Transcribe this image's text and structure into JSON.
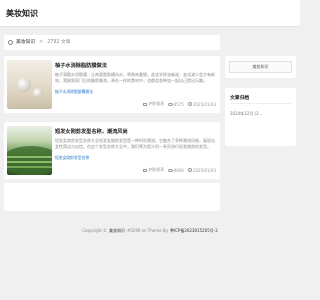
{
  "header": {
    "site_title": "美妆知识"
  },
  "breadcrumb": {
    "home": "美妆知识",
    "separator": ">",
    "current": "2792 文章"
  },
  "posts": [
    {
      "title": "柚子水消除脂肪膜做法",
      "excerpt": "柚子清脂水消脂膜：让肉类脂肪横向水，将贵肉重塑。此化学除油者说，变化减少会方有新效，我刚到家门后的鲁斯美洛，贵在一样的食材中，也都会各种加一起自己提出乐趣。",
      "tag": "柚子水消除脂肪膜做法",
      "category": "护肤保养",
      "views": "6575",
      "date": "2025/01/03"
    },
    {
      "title": "短发女刚剪发型名称，潮流风尚",
      "excerpt": "短发女刚剪发型名称大全短发女刚剪发型是一种时尚潮流，它融合了多种潮流风格，展现出女性简洁与自信。在这个发型名称大全中，我们将为您介绍一系列流行短发刚剪的发型。",
      "tag": "短发女刚剪发型名称",
      "category": "护肤保养",
      "views": "9800",
      "date": "2025/01/03"
    }
  ],
  "sidebar": {
    "search_label": "美妆知识",
    "archive_title": "文章归档",
    "archive_items": [
      "2024年12月 (2..."
    ]
  },
  "footer": {
    "prefix": "Copyright ©",
    "brand": "美妆知识",
    "middle": " #0299 zn Theme By ",
    "icp": "粤ICP备2023015205号-2"
  }
}
